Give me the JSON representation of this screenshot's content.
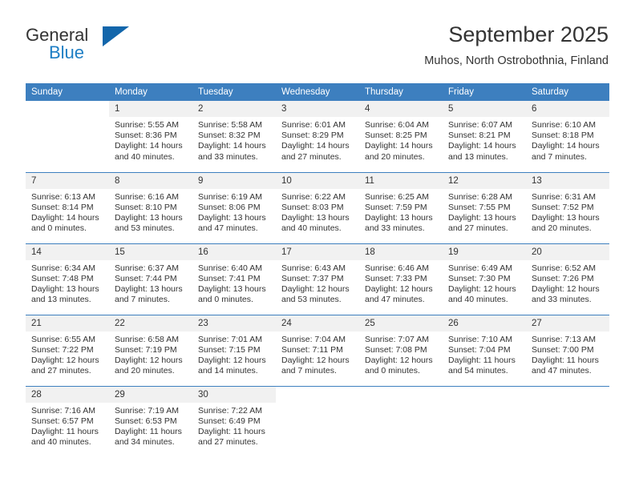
{
  "brand": {
    "line1": "General",
    "line2": "Blue",
    "triangle_color": "#1266ab",
    "blue_text_color": "#1d7ec4"
  },
  "header": {
    "month_title": "September 2025",
    "location": "Muhos, North Ostrobothnia, Finland"
  },
  "theme": {
    "header_blue": "#3d7fbf",
    "daynum_band": "#f1f1f1",
    "text": "#333333"
  },
  "calendar": {
    "weekday_headers": [
      "Sunday",
      "Monday",
      "Tuesday",
      "Wednesday",
      "Thursday",
      "Friday",
      "Saturday"
    ],
    "weeks": [
      [
        {
          "day": "",
          "sunrise": "",
          "sunset": "",
          "daylight_line1": "",
          "daylight_line2": ""
        },
        {
          "day": "1",
          "sunrise": "Sunrise: 5:55 AM",
          "sunset": "Sunset: 8:36 PM",
          "daylight_line1": "Daylight: 14 hours",
          "daylight_line2": "and 40 minutes."
        },
        {
          "day": "2",
          "sunrise": "Sunrise: 5:58 AM",
          "sunset": "Sunset: 8:32 PM",
          "daylight_line1": "Daylight: 14 hours",
          "daylight_line2": "and 33 minutes."
        },
        {
          "day": "3",
          "sunrise": "Sunrise: 6:01 AM",
          "sunset": "Sunset: 8:29 PM",
          "daylight_line1": "Daylight: 14 hours",
          "daylight_line2": "and 27 minutes."
        },
        {
          "day": "4",
          "sunrise": "Sunrise: 6:04 AM",
          "sunset": "Sunset: 8:25 PM",
          "daylight_line1": "Daylight: 14 hours",
          "daylight_line2": "and 20 minutes."
        },
        {
          "day": "5",
          "sunrise": "Sunrise: 6:07 AM",
          "sunset": "Sunset: 8:21 PM",
          "daylight_line1": "Daylight: 14 hours",
          "daylight_line2": "and 13 minutes."
        },
        {
          "day": "6",
          "sunrise": "Sunrise: 6:10 AM",
          "sunset": "Sunset: 8:18 PM",
          "daylight_line1": "Daylight: 14 hours",
          "daylight_line2": "and 7 minutes."
        }
      ],
      [
        {
          "day": "7",
          "sunrise": "Sunrise: 6:13 AM",
          "sunset": "Sunset: 8:14 PM",
          "daylight_line1": "Daylight: 14 hours",
          "daylight_line2": "and 0 minutes."
        },
        {
          "day": "8",
          "sunrise": "Sunrise: 6:16 AM",
          "sunset": "Sunset: 8:10 PM",
          "daylight_line1": "Daylight: 13 hours",
          "daylight_line2": "and 53 minutes."
        },
        {
          "day": "9",
          "sunrise": "Sunrise: 6:19 AM",
          "sunset": "Sunset: 8:06 PM",
          "daylight_line1": "Daylight: 13 hours",
          "daylight_line2": "and 47 minutes."
        },
        {
          "day": "10",
          "sunrise": "Sunrise: 6:22 AM",
          "sunset": "Sunset: 8:03 PM",
          "daylight_line1": "Daylight: 13 hours",
          "daylight_line2": "and 40 minutes."
        },
        {
          "day": "11",
          "sunrise": "Sunrise: 6:25 AM",
          "sunset": "Sunset: 7:59 PM",
          "daylight_line1": "Daylight: 13 hours",
          "daylight_line2": "and 33 minutes."
        },
        {
          "day": "12",
          "sunrise": "Sunrise: 6:28 AM",
          "sunset": "Sunset: 7:55 PM",
          "daylight_line1": "Daylight: 13 hours",
          "daylight_line2": "and 27 minutes."
        },
        {
          "day": "13",
          "sunrise": "Sunrise: 6:31 AM",
          "sunset": "Sunset: 7:52 PM",
          "daylight_line1": "Daylight: 13 hours",
          "daylight_line2": "and 20 minutes."
        }
      ],
      [
        {
          "day": "14",
          "sunrise": "Sunrise: 6:34 AM",
          "sunset": "Sunset: 7:48 PM",
          "daylight_line1": "Daylight: 13 hours",
          "daylight_line2": "and 13 minutes."
        },
        {
          "day": "15",
          "sunrise": "Sunrise: 6:37 AM",
          "sunset": "Sunset: 7:44 PM",
          "daylight_line1": "Daylight: 13 hours",
          "daylight_line2": "and 7 minutes."
        },
        {
          "day": "16",
          "sunrise": "Sunrise: 6:40 AM",
          "sunset": "Sunset: 7:41 PM",
          "daylight_line1": "Daylight: 13 hours",
          "daylight_line2": "and 0 minutes."
        },
        {
          "day": "17",
          "sunrise": "Sunrise: 6:43 AM",
          "sunset": "Sunset: 7:37 PM",
          "daylight_line1": "Daylight: 12 hours",
          "daylight_line2": "and 53 minutes."
        },
        {
          "day": "18",
          "sunrise": "Sunrise: 6:46 AM",
          "sunset": "Sunset: 7:33 PM",
          "daylight_line1": "Daylight: 12 hours",
          "daylight_line2": "and 47 minutes."
        },
        {
          "day": "19",
          "sunrise": "Sunrise: 6:49 AM",
          "sunset": "Sunset: 7:30 PM",
          "daylight_line1": "Daylight: 12 hours",
          "daylight_line2": "and 40 minutes."
        },
        {
          "day": "20",
          "sunrise": "Sunrise: 6:52 AM",
          "sunset": "Sunset: 7:26 PM",
          "daylight_line1": "Daylight: 12 hours",
          "daylight_line2": "and 33 minutes."
        }
      ],
      [
        {
          "day": "21",
          "sunrise": "Sunrise: 6:55 AM",
          "sunset": "Sunset: 7:22 PM",
          "daylight_line1": "Daylight: 12 hours",
          "daylight_line2": "and 27 minutes."
        },
        {
          "day": "22",
          "sunrise": "Sunrise: 6:58 AM",
          "sunset": "Sunset: 7:19 PM",
          "daylight_line1": "Daylight: 12 hours",
          "daylight_line2": "and 20 minutes."
        },
        {
          "day": "23",
          "sunrise": "Sunrise: 7:01 AM",
          "sunset": "Sunset: 7:15 PM",
          "daylight_line1": "Daylight: 12 hours",
          "daylight_line2": "and 14 minutes."
        },
        {
          "day": "24",
          "sunrise": "Sunrise: 7:04 AM",
          "sunset": "Sunset: 7:11 PM",
          "daylight_line1": "Daylight: 12 hours",
          "daylight_line2": "and 7 minutes."
        },
        {
          "day": "25",
          "sunrise": "Sunrise: 7:07 AM",
          "sunset": "Sunset: 7:08 PM",
          "daylight_line1": "Daylight: 12 hours",
          "daylight_line2": "and 0 minutes."
        },
        {
          "day": "26",
          "sunrise": "Sunrise: 7:10 AM",
          "sunset": "Sunset: 7:04 PM",
          "daylight_line1": "Daylight: 11 hours",
          "daylight_line2": "and 54 minutes."
        },
        {
          "day": "27",
          "sunrise": "Sunrise: 7:13 AM",
          "sunset": "Sunset: 7:00 PM",
          "daylight_line1": "Daylight: 11 hours",
          "daylight_line2": "and 47 minutes."
        }
      ],
      [
        {
          "day": "28",
          "sunrise": "Sunrise: 7:16 AM",
          "sunset": "Sunset: 6:57 PM",
          "daylight_line1": "Daylight: 11 hours",
          "daylight_line2": "and 40 minutes."
        },
        {
          "day": "29",
          "sunrise": "Sunrise: 7:19 AM",
          "sunset": "Sunset: 6:53 PM",
          "daylight_line1": "Daylight: 11 hours",
          "daylight_line2": "and 34 minutes."
        },
        {
          "day": "30",
          "sunrise": "Sunrise: 7:22 AM",
          "sunset": "Sunset: 6:49 PM",
          "daylight_line1": "Daylight: 11 hours",
          "daylight_line2": "and 27 minutes."
        },
        {
          "day": "",
          "sunrise": "",
          "sunset": "",
          "daylight_line1": "",
          "daylight_line2": ""
        },
        {
          "day": "",
          "sunrise": "",
          "sunset": "",
          "daylight_line1": "",
          "daylight_line2": ""
        },
        {
          "day": "",
          "sunrise": "",
          "sunset": "",
          "daylight_line1": "",
          "daylight_line2": ""
        },
        {
          "day": "",
          "sunrise": "",
          "sunset": "",
          "daylight_line1": "",
          "daylight_line2": ""
        }
      ]
    ]
  }
}
